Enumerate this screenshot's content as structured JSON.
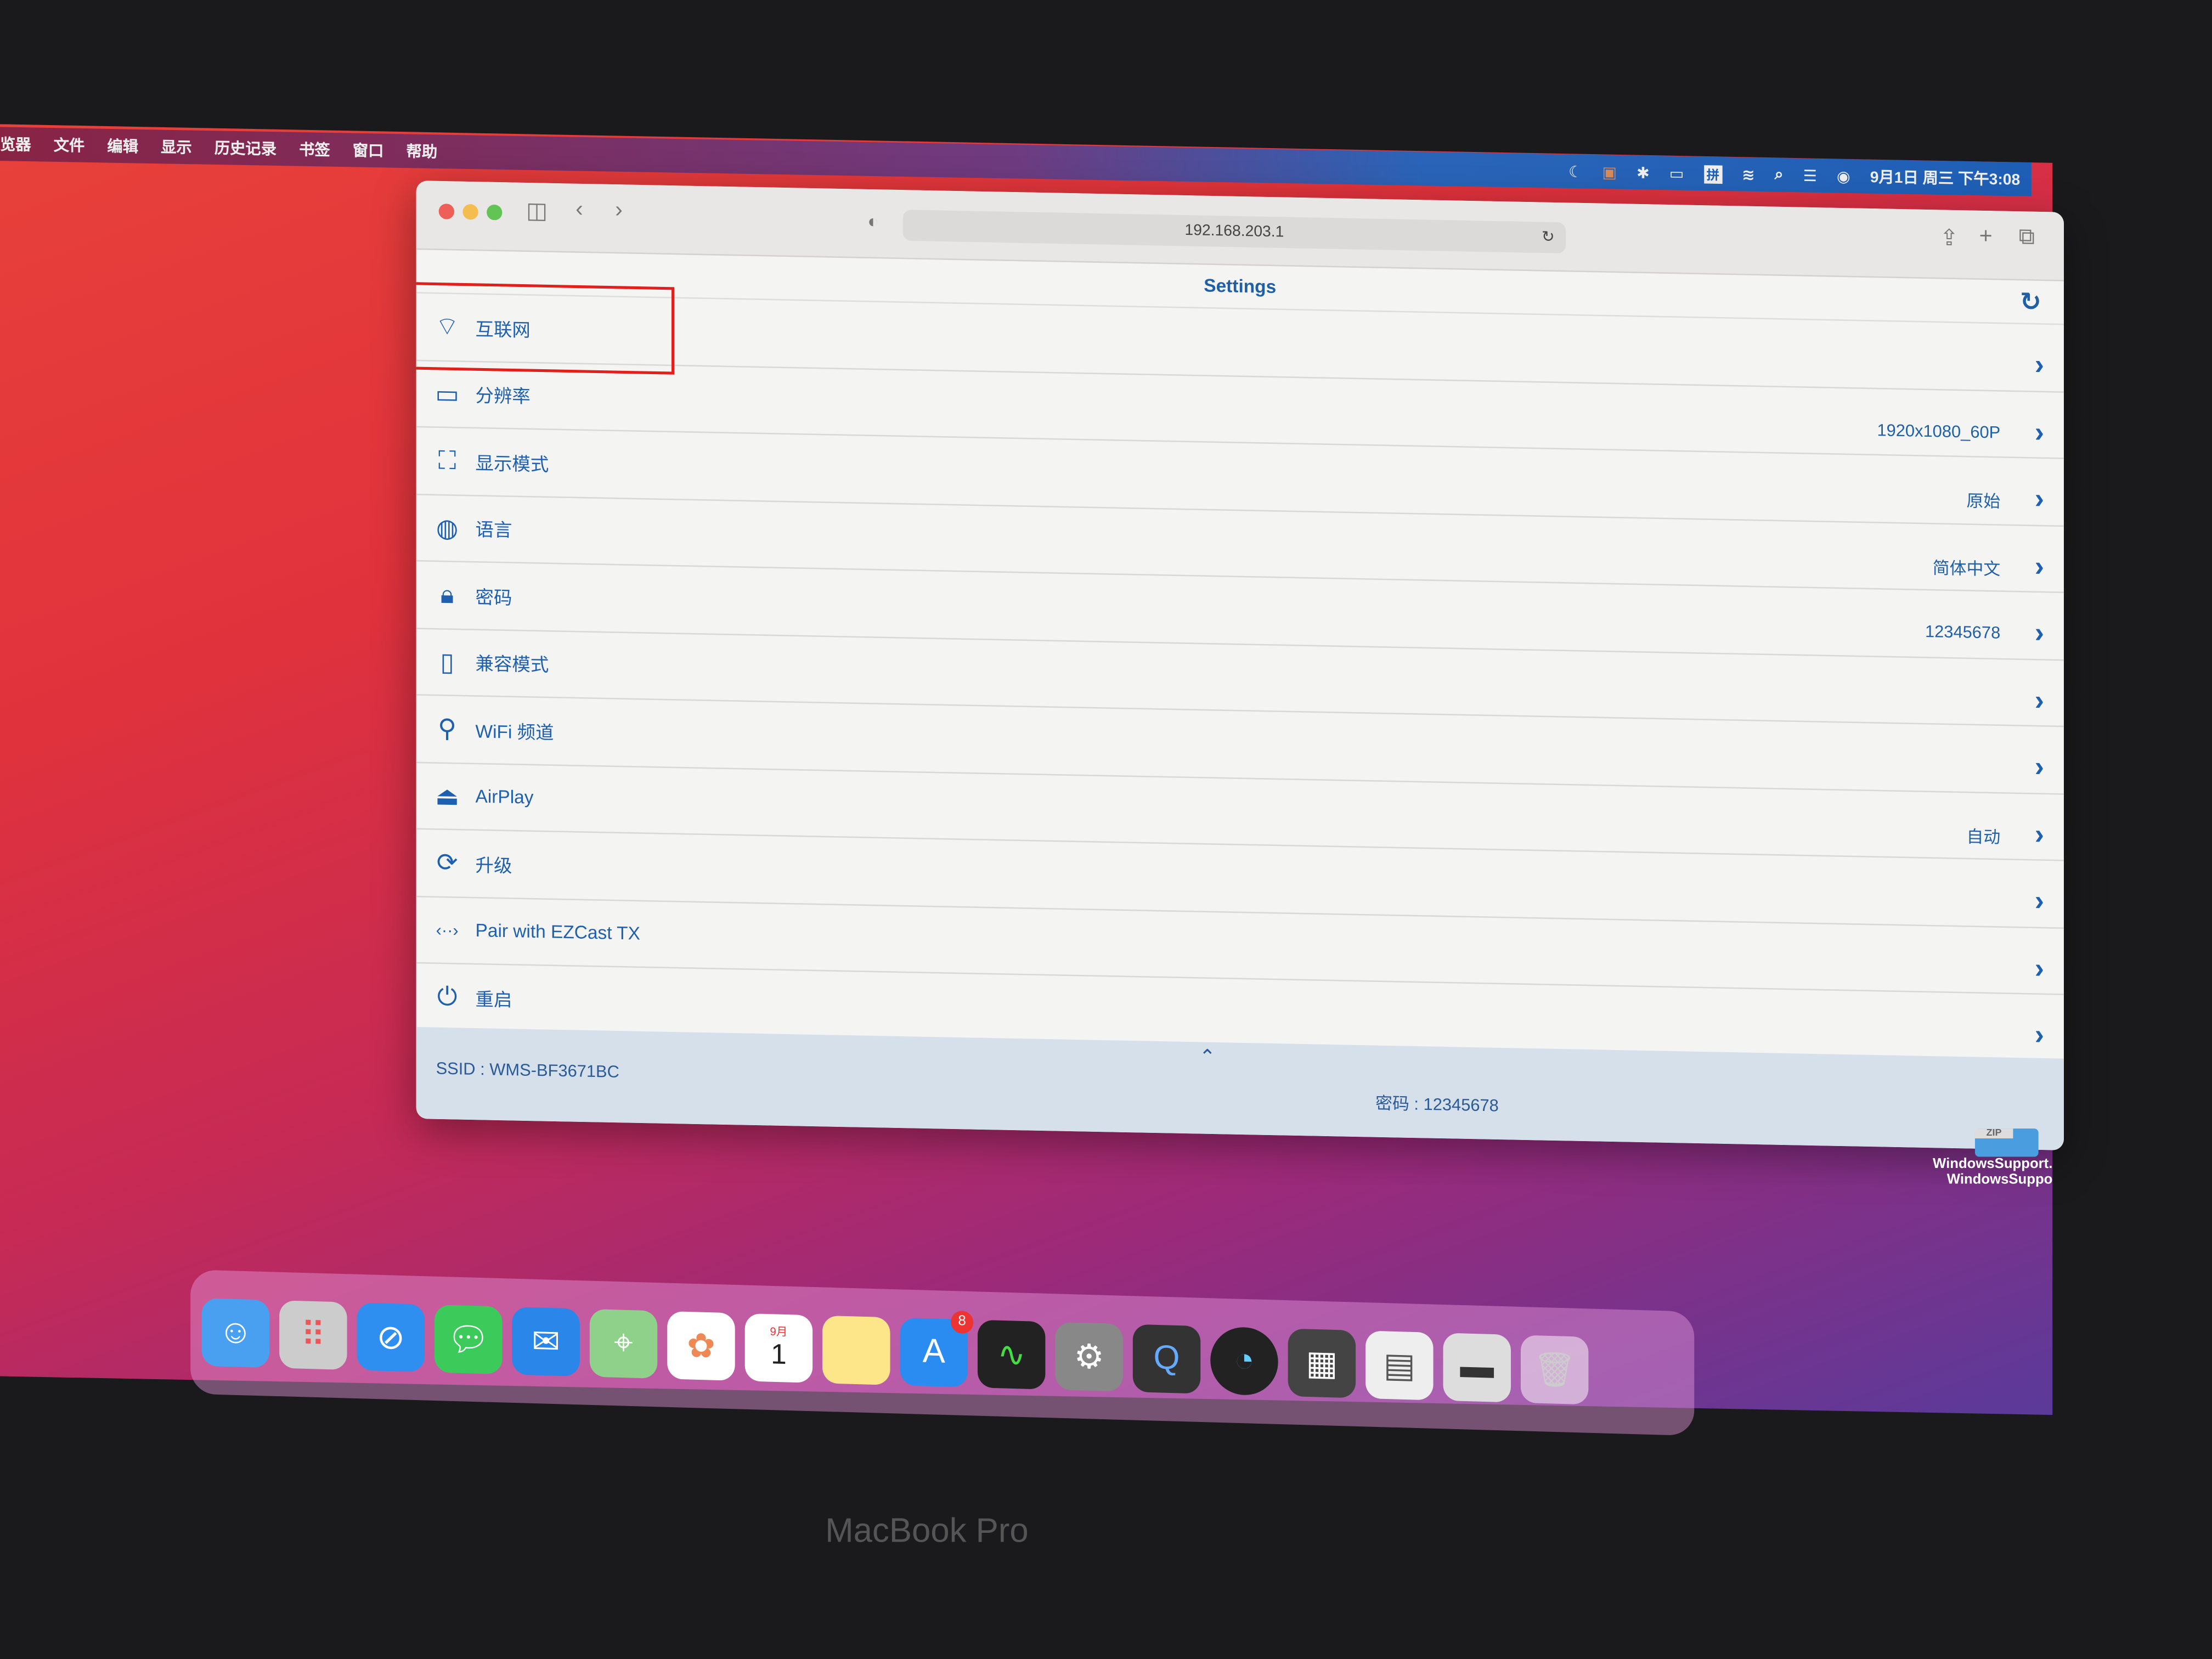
{
  "menubar": {
    "items": [
      "览器",
      "文件",
      "编辑",
      "显示",
      "历史记录",
      "书签",
      "窗口",
      "帮助"
    ],
    "clock": "9月1日 周三 下午3:08",
    "input_method": "拼"
  },
  "browser": {
    "url": "192.168.203.1"
  },
  "settings": {
    "title": "Settings",
    "items": [
      {
        "label": "互联网",
        "value": "",
        "icon": "wifi-globe-icon"
      },
      {
        "label": "分辨率",
        "value": "1920x1080_60P",
        "icon": "monitor-icon"
      },
      {
        "label": "显示模式",
        "value": "原始",
        "icon": "display-mode-icon"
      },
      {
        "label": "语言",
        "value": "简体中文",
        "icon": "globe-icon"
      },
      {
        "label": "密码",
        "value": "12345678",
        "icon": "lock-icon"
      },
      {
        "label": "兼容模式",
        "value": "",
        "icon": "phone-icon"
      },
      {
        "label": "WiFi 频道",
        "value": "",
        "icon": "antenna-icon"
      },
      {
        "label": "AirPlay",
        "value": "自动",
        "icon": "airplay-icon"
      },
      {
        "label": "升级",
        "value": "",
        "icon": "upgrade-icon"
      },
      {
        "label": "Pair with EZCast TX",
        "value": "",
        "icon": "pair-icon"
      },
      {
        "label": "重启",
        "value": "",
        "icon": "power-icon"
      }
    ],
    "footer": {
      "ssid": "SSID : WMS-BF3671BC",
      "password": "密码 : 12345678"
    }
  },
  "desktop": {
    "file1": "WindowsSupport.",
    "file2": "WindowsSuppo",
    "file_tag": "ZIP"
  },
  "dock": {
    "calendar_month": "9月",
    "calendar_day": "1",
    "appstore_badge": "8"
  },
  "bezel": {
    "label": "MacBook Pro"
  },
  "colors": {
    "accent": "#1e5fb0",
    "highlight": "#e0201c"
  }
}
